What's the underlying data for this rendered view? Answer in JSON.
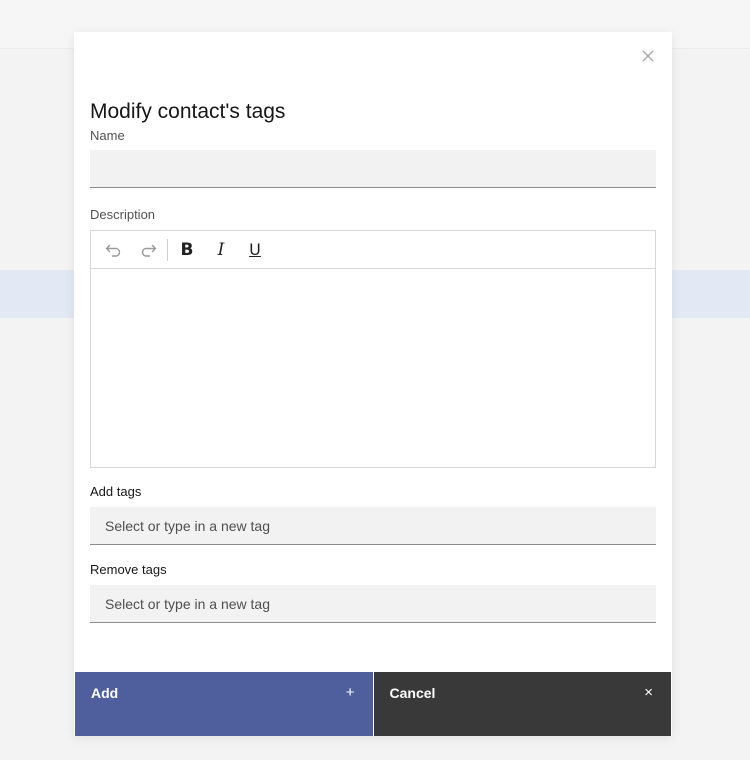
{
  "modal": {
    "title": "Modify contact's tags",
    "close_icon": "close-icon"
  },
  "name_field": {
    "label": "Name",
    "value": ""
  },
  "description_field": {
    "label": "Description",
    "toolbar": {
      "undo_icon": "undo-icon",
      "redo_icon": "redo-icon",
      "bold_icon": "bold-icon",
      "italic_icon": "italic-icon",
      "underline_icon": "underline-icon"
    },
    "value": ""
  },
  "add_tags": {
    "label": "Add tags",
    "placeholder": "Select or type in a new tag"
  },
  "remove_tags": {
    "label": "Remove tags",
    "placeholder": "Select or type in a new tag"
  },
  "footer": {
    "add_label": "Add",
    "add_icon": "+",
    "cancel_label": "Cancel",
    "cancel_icon": "×"
  },
  "colors": {
    "primary": "#4f5f9e",
    "secondary": "#393939"
  }
}
